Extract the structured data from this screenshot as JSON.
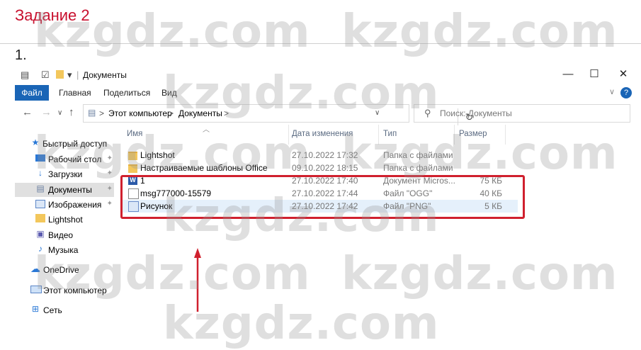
{
  "heading": {
    "task": "Задание 2",
    "number": "1."
  },
  "watermark": "kzgdz.com",
  "window": {
    "title": "Документы",
    "controls": {
      "minimize": "—",
      "maximize": "☐",
      "close": "✕"
    }
  },
  "ribbon": {
    "tabs": [
      "Файл",
      "Главная",
      "Поделиться",
      "Вид"
    ],
    "active_color": "#1a65b6",
    "help": "?",
    "expand": "∨"
  },
  "navigation": {
    "back": "←",
    "forward": "→",
    "recent": "∨",
    "up": "↑",
    "path": [
      "Этот компьютер",
      "Документы"
    ],
    "separator": ">",
    "dropdown": "∨",
    "refresh": "↻",
    "search_placeholder": "Поиск: Документы"
  },
  "sidebar": {
    "items": [
      {
        "label": "Быстрый доступ",
        "icon": "star-icon"
      },
      {
        "label": "Рабочий стол",
        "icon": "desktop-icon",
        "pinned": true
      },
      {
        "label": "Загрузки",
        "icon": "download-icon",
        "pinned": true
      },
      {
        "label": "Документы",
        "icon": "document-icon",
        "pinned": true,
        "selected": true
      },
      {
        "label": "Изображения",
        "icon": "picture-icon",
        "pinned": true
      },
      {
        "label": "Lightshot",
        "icon": "folder-icon"
      },
      {
        "label": "Видео",
        "icon": "video-icon"
      },
      {
        "label": "Музыка",
        "icon": "music-icon"
      },
      {
        "label": "OneDrive",
        "icon": "cloud-icon"
      },
      {
        "label": "Этот компьютер",
        "icon": "computer-icon"
      },
      {
        "label": "Сеть",
        "icon": "network-icon"
      }
    ]
  },
  "file_list": {
    "columns": [
      "Имя",
      "Дата изменения",
      "Тип",
      "Размер"
    ],
    "rows": [
      {
        "name": "Lightshot",
        "date": "27.10.2022 17:32",
        "type": "Папка с файлами",
        "size": "",
        "icon": "folder-icon"
      },
      {
        "name": "Настраиваемые шаблоны Office",
        "date": "09.10.2022 18:15",
        "type": "Папка с файлами",
        "size": "",
        "icon": "folder-icon"
      },
      {
        "name": "1",
        "date": "27.10.2022 17:40",
        "type": "Документ Micros...",
        "size": "75 КБ",
        "icon": "word-document-icon"
      },
      {
        "name": "msg777000-15579",
        "date": "27.10.2022 17:44",
        "type": "Файл \"OGG\"",
        "size": "40 КБ",
        "icon": "audio-file-icon"
      },
      {
        "name": "Рисунок",
        "date": "27.10.2022 17:42",
        "type": "Файл \"PNG\"",
        "size": "5 КБ",
        "icon": "image-file-icon"
      }
    ]
  },
  "annotation_color": "#d0202e"
}
